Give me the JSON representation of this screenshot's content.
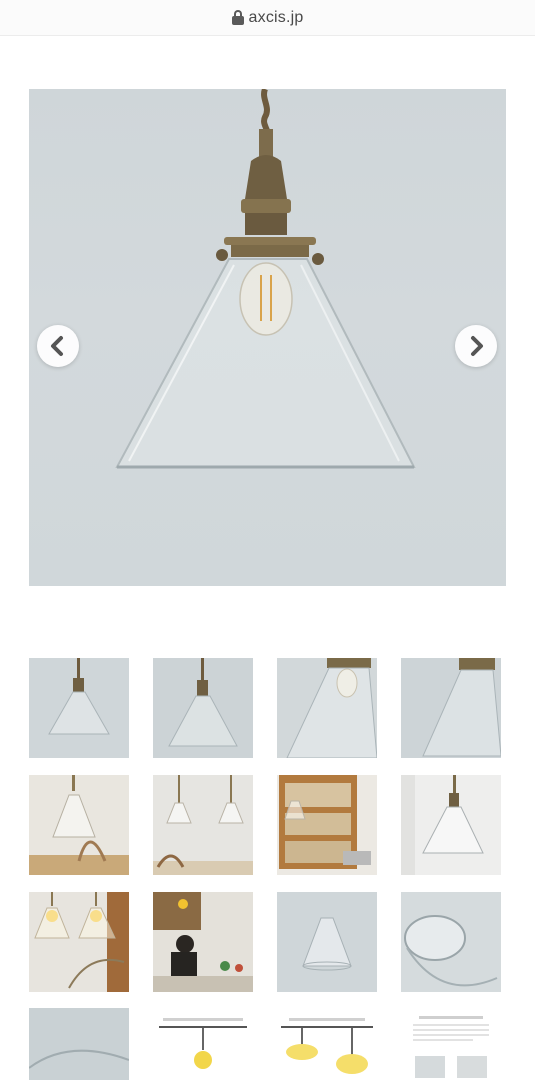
{
  "browser": {
    "url": "axcis.jp",
    "lock_icon": "lock-icon"
  },
  "gallery": {
    "main_image": "pendant-lamp-glass-shade-photo",
    "prev_icon": "chevron-left-icon",
    "next_icon": "chevron-right-icon",
    "thumbnails": [
      "thumb-pendant-front",
      "thumb-pendant-front-2",
      "thumb-pendant-closeup",
      "thumb-pendant-angle",
      "thumb-pendant-dining",
      "thumb-pendant-pair-dining",
      "thumb-pendant-shelf",
      "thumb-pendant-window",
      "thumb-pendant-lit-pair",
      "thumb-pendant-kitchen",
      "thumb-glass-shade-only",
      "thumb-glass-shade-top",
      "thumb-glass-detail",
      "thumb-diagram-glass",
      "thumb-diagram-cord",
      "thumb-spec-sheet"
    ]
  },
  "colors": {
    "accent_bulb": "#f2c230",
    "glass_edge": "#a9b4b8",
    "brass": "#7a6a4a"
  }
}
